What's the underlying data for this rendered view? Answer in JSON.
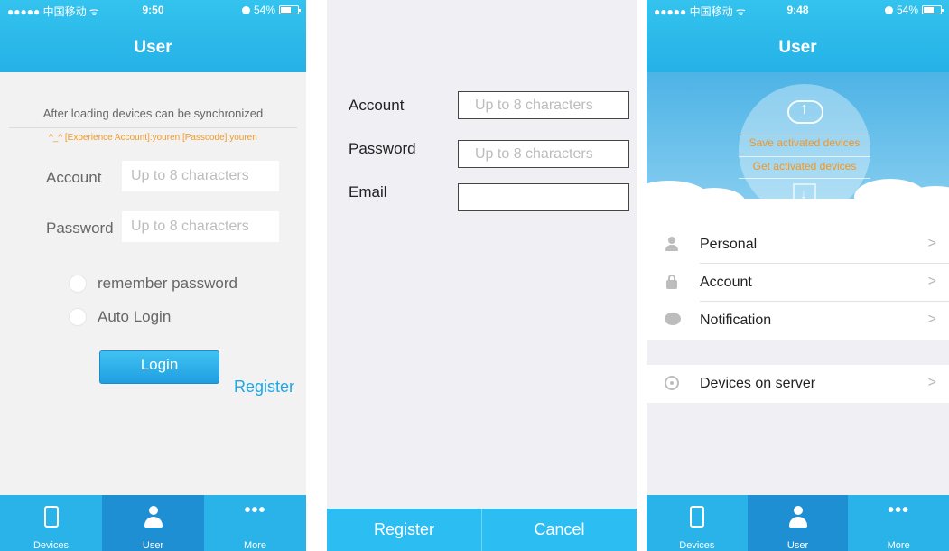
{
  "screen1": {
    "status": {
      "carrier": "●●●●● 中国移动 ᯤ",
      "time": "9:50",
      "battery": "54%"
    },
    "title": "User",
    "info_text": "After loading devices can be synchronized",
    "hint_text": "^_^ [Experience Account]:youren [Passcode]:youren",
    "account_label": "Account",
    "account_placeholder": "Up to 8 characters",
    "password_label": "Password",
    "password_placeholder": "Up to 8 characters",
    "remember_label": "remember password",
    "auto_login_label": "Auto Login",
    "login_label": "Login",
    "register_label": "Register",
    "tabs": [
      "Devices",
      "User",
      "More"
    ]
  },
  "screen2": {
    "account_label": "Account",
    "account_placeholder": "Up to 8 characters",
    "password_label": "Password",
    "password_placeholder": "Up to 8 characters",
    "email_label": "Email",
    "email_placeholder": "",
    "register_label": "Register",
    "cancel_label": "Cancel"
  },
  "screen3": {
    "status": {
      "carrier": "●●●●● 中国移动 ᯤ",
      "time": "9:48",
      "battery": "54%"
    },
    "title": "User",
    "save_text": "Save activated devices",
    "get_text": "Get activated devices",
    "menu": [
      {
        "label": "Personal",
        "icon": "person-icon"
      },
      {
        "label": "Account",
        "icon": "lock-icon"
      },
      {
        "label": "Notification",
        "icon": "chat-bubble-icon"
      }
    ],
    "server_item": {
      "label": "Devices on server",
      "icon": "signal-icon"
    },
    "chevron": ">",
    "tabs": [
      "Devices",
      "User",
      "More"
    ]
  },
  "colors": {
    "accent": "#29b3e8",
    "tab_active": "#1f8fd4",
    "hint": "#f09a2a",
    "link": "#1fa6e6"
  }
}
